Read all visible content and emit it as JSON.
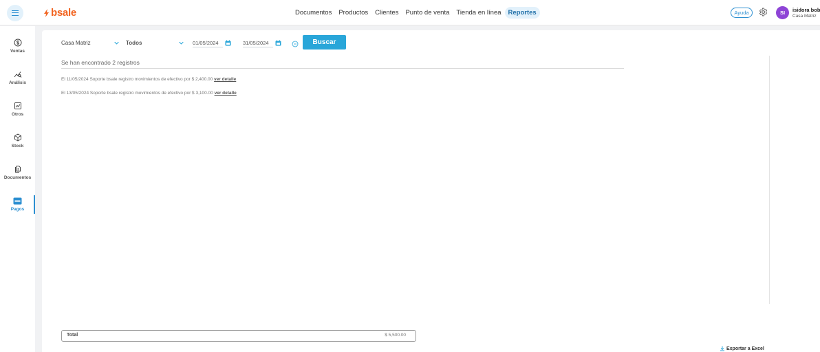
{
  "brand": {
    "name": "bsale",
    "color": "#f26522"
  },
  "nav": {
    "items": [
      {
        "label": "Documentos",
        "active": false
      },
      {
        "label": "Productos",
        "active": false
      },
      {
        "label": "Clientes",
        "active": false
      },
      {
        "label": "Punto de venta",
        "active": false
      },
      {
        "label": "Tienda en línea",
        "active": false
      },
      {
        "label": "Reportes",
        "active": true
      }
    ]
  },
  "header": {
    "help_label": "Ayuda",
    "user_initials": "SI",
    "user_name": "isidora bobi",
    "user_branch": "Casa Matriz"
  },
  "sidebar": {
    "items": [
      {
        "label": "Ventas",
        "icon": "dollar-circle-icon",
        "active": false
      },
      {
        "label": "Análisis",
        "icon": "analytics-icon",
        "active": false
      },
      {
        "label": "Otros",
        "icon": "chart-icon",
        "active": false
      },
      {
        "label": "Stock",
        "icon": "box-icon",
        "active": false
      },
      {
        "label": "Documentos",
        "icon": "documents-icon",
        "active": false
      },
      {
        "label": "Pagos",
        "icon": "payment-card-icon",
        "active": true
      }
    ]
  },
  "filters": {
    "branch": "Casa Matriz",
    "type": "Todos",
    "date_from": "01/05/2024",
    "date_to": "31/05/2024",
    "search_label": "Buscar"
  },
  "results": {
    "count_text": "Se han encontrado 2 registros",
    "records": [
      {
        "text": "El 11/05/2024 Soporte bsale registro movimientos de efectivo por $ 2,400.00",
        "link": "ver detalle"
      },
      {
        "text": "El 13/05/2024 Soporte bsale registro movimientos de efectivo por $ 3,100.00",
        "link": "ver detalle"
      }
    ]
  },
  "footer": {
    "total_label": "Total",
    "total_value": "$ 5,500.00",
    "export_label": "Exportar a Excel"
  },
  "colors": {
    "accent": "#29a6d9",
    "avatar": "#8e44d6"
  }
}
